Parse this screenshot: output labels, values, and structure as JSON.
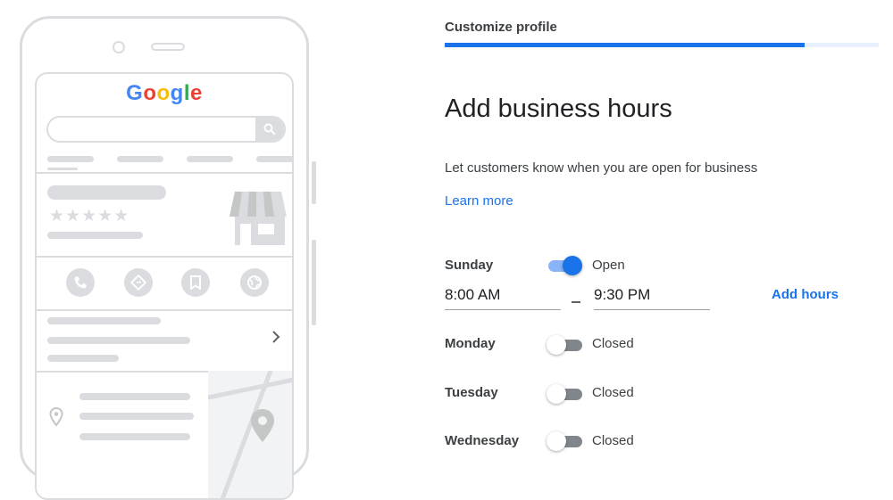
{
  "illustration": {
    "logo": {
      "letters": [
        "G",
        "o",
        "o",
        "g",
        "l",
        "e"
      ],
      "colors": [
        "#4285F4",
        "#EA4335",
        "#FBBC05",
        "#4285F4",
        "#34A853",
        "#EA4335"
      ]
    },
    "rating_stars": "★★★★★",
    "icons": [
      "search-icon",
      "store-icon",
      "phone-icon",
      "directions-icon",
      "bookmark-icon",
      "globe-icon",
      "chevron-right-icon",
      "location-pin-icon",
      "map-pin-icon"
    ]
  },
  "header": {
    "step_title": "Customize profile",
    "progress_fraction": 0.83
  },
  "main": {
    "heading": "Add business hours",
    "subtext": "Let customers know when you are open for business",
    "learn_more": "Learn more",
    "days": [
      {
        "day": "Sunday",
        "open": true,
        "status": "Open",
        "start": "8:00 AM",
        "end": "9:30 PM",
        "add_hours": "Add hours"
      },
      {
        "day": "Monday",
        "open": false,
        "status": "Closed"
      },
      {
        "day": "Tuesday",
        "open": false,
        "status": "Closed"
      },
      {
        "day": "Wednesday",
        "open": false,
        "status": "Closed"
      }
    ]
  },
  "colors": {
    "accent": "#1a73e8",
    "accent_light": "#8ab4f8",
    "placeholder_gray": "#dadce0",
    "text": "#3c4043"
  }
}
